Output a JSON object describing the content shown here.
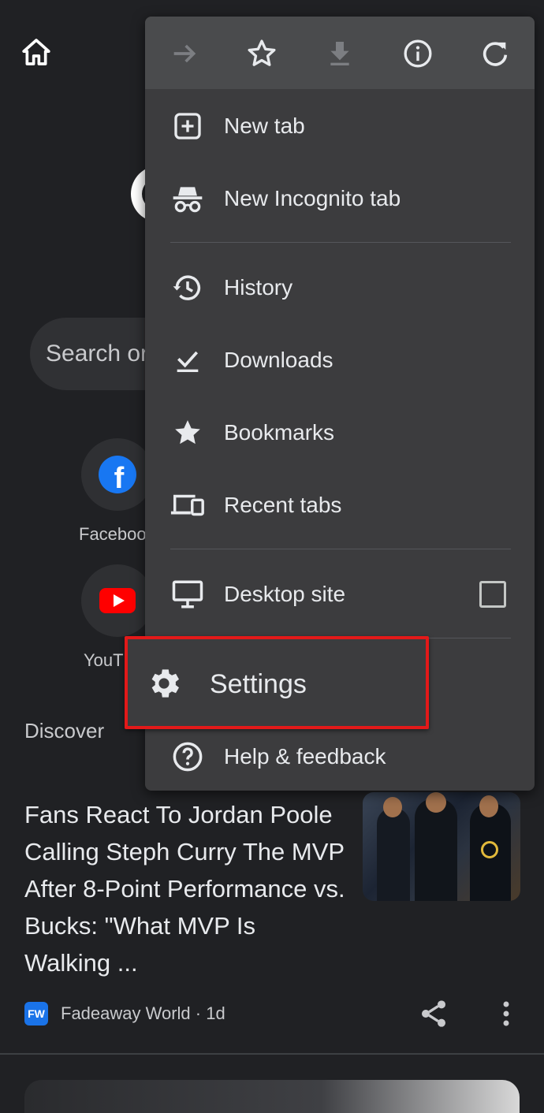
{
  "background_page": {
    "search_placeholder": "Search or",
    "shortcuts": [
      {
        "label": "Faceboo",
        "icon": "facebook-icon"
      },
      {
        "label": "YouT",
        "icon": "youtube-icon"
      }
    ],
    "discover_label": "Discover",
    "article": {
      "title": "Fans React To Jordan Poole Calling Steph Curry The MVP After 8-Point Performance vs. Bucks: \"What MVP Is Walking ...",
      "source_badge": "FW",
      "source": "Fadeaway World · 1d"
    }
  },
  "menu": {
    "toolbar": [
      {
        "name": "forward-icon",
        "enabled": false
      },
      {
        "name": "star-outline-icon",
        "enabled": true
      },
      {
        "name": "download-icon",
        "enabled": false
      },
      {
        "name": "info-icon",
        "enabled": true
      },
      {
        "name": "refresh-icon",
        "enabled": true
      }
    ],
    "items": {
      "new_tab": "New tab",
      "new_incognito_tab": "New Incognito tab",
      "history": "History",
      "downloads": "Downloads",
      "bookmarks": "Bookmarks",
      "recent_tabs": "Recent tabs",
      "desktop_site": "Desktop site",
      "settings": "Settings",
      "help_feedback": "Help & feedback"
    },
    "desktop_site_checked": false
  },
  "colors": {
    "page_bg": "#202124",
    "menu_bg": "#3c3c3e",
    "toolbar_bg": "#4a4b4d",
    "highlight_border": "#e31919"
  }
}
